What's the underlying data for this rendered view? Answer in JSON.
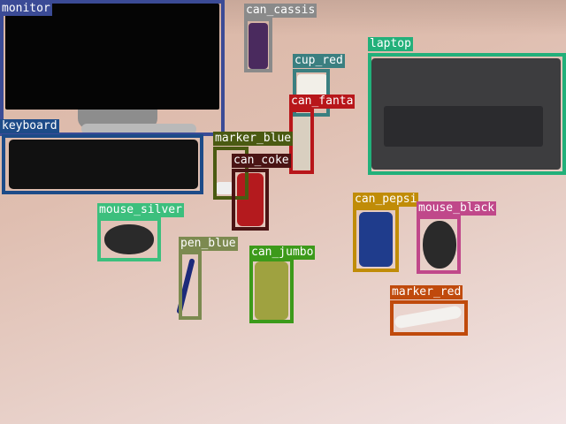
{
  "detections": [
    {
      "label": "monitor",
      "color": "#3b4b96"
    },
    {
      "label": "can_cassis",
      "color": "#8a8a8a"
    },
    {
      "label": "cup_red",
      "color": "#3b7f80"
    },
    {
      "label": "laptop",
      "color": "#22b07a"
    },
    {
      "label": "can_fanta",
      "color": "#b8161a"
    },
    {
      "label": "keyboard",
      "color": "#1d4b88"
    },
    {
      "label": "marker_blue",
      "color": "#4a5a12"
    },
    {
      "label": "can_coke",
      "color": "#4a1414"
    },
    {
      "label": "mouse_silver",
      "color": "#3cbf7d"
    },
    {
      "label": "can_pepsi",
      "color": "#c08c08"
    },
    {
      "label": "mouse_black",
      "color": "#c0488a"
    },
    {
      "label": "pen_blue",
      "color": "#7c8a50"
    },
    {
      "label": "can_jumbo",
      "color": "#3c9a1a"
    },
    {
      "label": "marker_red",
      "color": "#c04a0c"
    }
  ]
}
